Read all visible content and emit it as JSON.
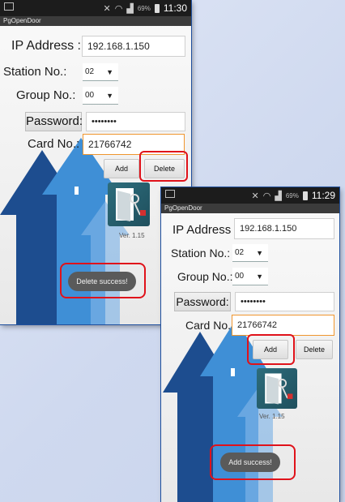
{
  "screens": [
    {
      "status": {
        "signal_pct": "69%",
        "time": "11:30"
      },
      "app_title": "PgOpenDoor",
      "ip_label": "IP Address :",
      "ip_value": "192.168.1.150",
      "station_label": "Station No.:",
      "station_value": "02",
      "group_label": "Group No.:",
      "group_value": "00",
      "password_label": "Password:",
      "password_value": "••••••••",
      "card_label": "Card No.:",
      "card_value": "21766742",
      "add_label": "Add",
      "delete_label": "Delete",
      "version": "Ver. 1.15",
      "toast": "Delete success!"
    },
    {
      "status": {
        "signal_pct": "69%",
        "time": "11:29"
      },
      "app_title": "PgOpenDoor",
      "ip_label": "IP Address :",
      "ip_value": "192.168.1.150",
      "station_label": "Station No.:",
      "station_value": "02",
      "group_label": "Group No.:",
      "group_value": "00",
      "password_label": "Password:",
      "password_value": "••••••••",
      "card_label": "Card No.:",
      "card_value": "21766742",
      "add_label": "Add",
      "delete_label": "Delete",
      "version": "Ver. 1.15",
      "toast": "Add success!"
    }
  ],
  "colors": {
    "highlight_ring": "#e0121a",
    "card_field_border": "#f0962e",
    "arrow_dark": "#1d4d8f",
    "arrow_light": "#3f8fd6",
    "background": "#d6def2"
  },
  "icons": [
    "picture-icon",
    "mute-icon",
    "wifi-icon",
    "signal-icon",
    "battery-icon",
    "dropdown-caret-icon",
    "door-key-icon",
    "arrow-graphic"
  ]
}
